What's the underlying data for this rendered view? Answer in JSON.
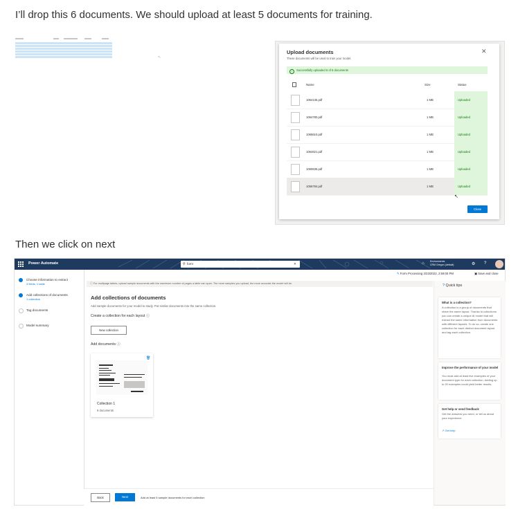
{
  "captions": {
    "first": "I’ll drop this 6 documents. We should upload at least 5 documents for training.",
    "second": "Then we click on next"
  },
  "upload_dialog": {
    "title": "Upload documents",
    "subtitle": "These documents will be used to train your model.",
    "close_icon": "close-icon",
    "success_message": "Successfully uploaded 6 of 6 documents",
    "columns": {
      "name": "Name",
      "size": "Size",
      "status": "Status"
    },
    "files": [
      {
        "name": "1064135.pdf",
        "size": "1 MB",
        "status": "Uploaded"
      },
      {
        "name": "1064780.pdf",
        "size": "1 MB",
        "status": "Uploaded"
      },
      {
        "name": "1065610.pdf",
        "size": "1 MB",
        "status": "Uploaded"
      },
      {
        "name": "1064621.pdf",
        "size": "1 MB",
        "status": "Uploaded"
      },
      {
        "name": "1060635.pdf",
        "size": "1 MB",
        "status": "Uploaded"
      },
      {
        "name": "1056784.pdf",
        "size": "1 MB",
        "status": "Uploaded"
      }
    ],
    "close_button": "Close"
  },
  "power_automate": {
    "app_name": "Power Automate",
    "search_value": "form",
    "environment": {
      "label": "Environments",
      "value": "CRM Oregon (default)"
    },
    "top_icons": [
      "settings-icon",
      "help-icon",
      "avatar"
    ],
    "steps": [
      {
        "title": "Choose information to extract",
        "sub": "3 fields, 1 table",
        "done": true
      },
      {
        "title": "Add collections of documents",
        "sub": "1 collection",
        "done": true
      },
      {
        "title": "Tag documents",
        "sub": "",
        "done": false
      },
      {
        "title": "Model summary",
        "sub": "",
        "done": false
      }
    ],
    "breadcrumb": "Form Processing 2/23/2022, 2:59:00 PM",
    "save_close": "Save and close",
    "info": "For multipage tables, upload sample documents with the maximum number of pages a table can span. The more samples you upload, the more accurate the model will be.",
    "heading": "Add collections of documents",
    "description": "Add sample documents for your model to study. Put similar documents into the same collection.",
    "collection_heading": "Create a collection for each layout",
    "new_collection": "New collection",
    "add_documents": "Add documents",
    "collection_card": {
      "title": "Collection 1",
      "count": "6 documents"
    },
    "back": "Back",
    "next": "Next",
    "footer_message": "Add at least 5 sample documents for each collection",
    "quick_tips": {
      "title": "Quick tips",
      "cards": [
        {
          "title": "What is a collection?",
          "body": "A collection is a group of documents that share the same layout. Thanks to collections you can create a unique AI model that will extract the same information from documents with different layouts. To do so, create one collection for each distinct document layout and tag each collection."
        },
        {
          "title": "Improve the performance of your model",
          "body": "You must add at least five examples of your document type for each collection. Adding up to 20 examples could yield better results."
        },
        {
          "title": "Get help or send feedback",
          "body": "Get the answers you need, or tell us about your experience.",
          "link": "Get help"
        }
      ]
    }
  }
}
